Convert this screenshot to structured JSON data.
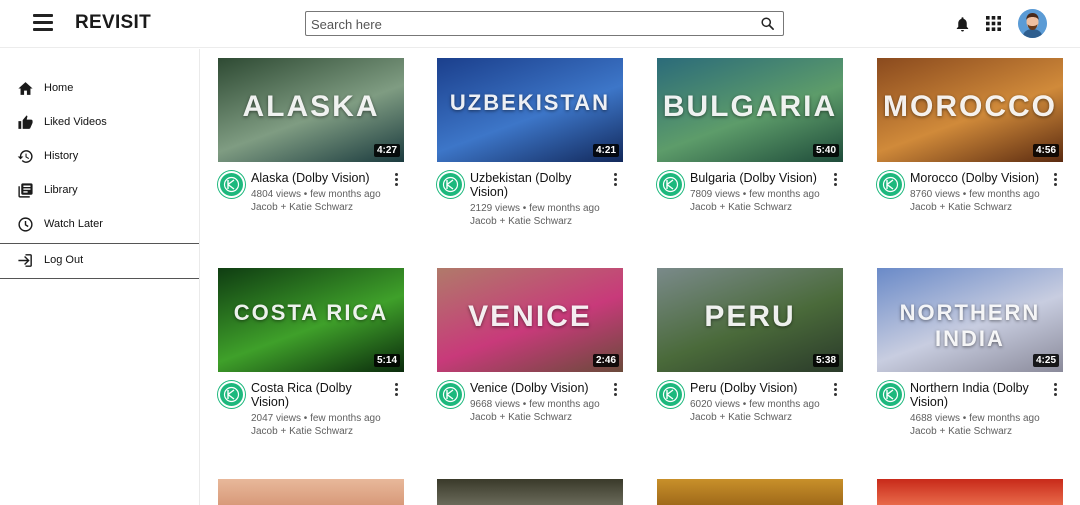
{
  "header": {
    "logo": "REVISIT",
    "search_placeholder": "Search here"
  },
  "sidebar": {
    "items": [
      {
        "label": "Home",
        "icon": "home-icon"
      },
      {
        "label": "Liked Videos",
        "icon": "thumbs-up-icon"
      },
      {
        "label": "History",
        "icon": "history-icon"
      },
      {
        "label": "Library",
        "icon": "library-icon"
      },
      {
        "label": "Watch Later",
        "icon": "clock-icon"
      },
      {
        "label": "Log Out",
        "icon": "logout-icon"
      }
    ]
  },
  "videos": [
    {
      "thumb_text": "ALASKA",
      "title": "Alaska (Dolby Vision)",
      "views": "4804 views • few months ago",
      "channel": "Jacob + Katie Schwarz",
      "duration": "4:27",
      "colors": [
        "#2e4a33",
        "#7f9c82",
        "#1a3a3e"
      ]
    },
    {
      "thumb_text": "UZBEKISTAN",
      "title": "Uzbekistan (Dolby Vision)",
      "views": "2129 views • few months ago",
      "channel": "Jacob + Katie Schwarz",
      "duration": "4:21",
      "colors": [
        "#1b3f8c",
        "#3d76c8",
        "#12285a"
      ]
    },
    {
      "thumb_text": "BULGARIA",
      "title": "Bulgaria (Dolby Vision)",
      "views": "7809 views • few months ago",
      "channel": "Jacob + Katie Schwarz",
      "duration": "5:40",
      "colors": [
        "#2b6b7a",
        "#5d9c6a",
        "#1e4b3a"
      ]
    },
    {
      "thumb_text": "MOROCCO",
      "title": "Morocco (Dolby Vision)",
      "views": "8760 views • few months ago",
      "channel": "Jacob + Katie Schwarz",
      "duration": "4:56",
      "colors": [
        "#8a4a1e",
        "#d08a3a",
        "#5a2a10"
      ]
    },
    {
      "thumb_text": "COSTA RICA",
      "title": "Costa Rica (Dolby Vision)",
      "views": "2047 views • few months ago",
      "channel": "Jacob + Katie Schwarz",
      "duration": "5:14",
      "colors": [
        "#0f3d12",
        "#3fa02a",
        "#0a2a0c"
      ]
    },
    {
      "thumb_text": "VENICE",
      "title": "Venice (Dolby Vision)",
      "views": "9668 views • few months ago",
      "channel": "Jacob + Katie Schwarz",
      "duration": "2:46",
      "colors": [
        "#b07a6a",
        "#c83a7a",
        "#6a4a3a"
      ]
    },
    {
      "thumb_text": "PERU",
      "title": "Peru (Dolby Vision)",
      "views": "6020 views • few months ago",
      "channel": "Jacob + Katie Schwarz",
      "duration": "5:38",
      "colors": [
        "#7a8a8a",
        "#4a6a3a",
        "#2a3a2a"
      ]
    },
    {
      "thumb_text": "NORTHERN INDIA",
      "title": "Northern India (Dolby Vision)",
      "views": "4688 views • few months ago",
      "channel": "Jacob + Katie Schwarz",
      "duration": "4:25",
      "colors": [
        "#6a8ac8",
        "#c8cde0",
        "#8a8a9a"
      ]
    }
  ],
  "partial_thumbs": [
    {
      "colors": [
        "#e8b89a",
        "#d89a7a"
      ]
    },
    {
      "colors": [
        "#3a3a2a",
        "#6a6a5a"
      ]
    },
    {
      "colors": [
        "#c8902a",
        "#a06a1a"
      ]
    },
    {
      "colors": [
        "#c82a1a",
        "#e86a4a"
      ]
    }
  ]
}
